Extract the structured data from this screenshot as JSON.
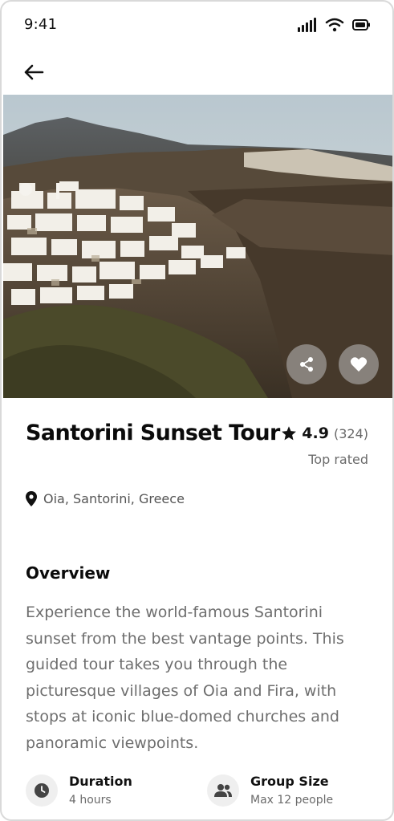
{
  "status_bar": {
    "time": "9:41"
  },
  "tour": {
    "title": "Santorini Sunset Tour",
    "rating": "4.9",
    "reviews": "(324)",
    "badge": "Top rated",
    "location": "Oia, Santorini, Greece"
  },
  "overview": {
    "title": "Overview",
    "description": "Experience the world-famous Santorini sunset from the best vantage points. This guided tour takes you through the picturesque villages of Oia and Fira, with stops at iconic blue-domed churches and panoramic viewpoints."
  },
  "details": [
    {
      "label": "Duration",
      "value": "4 hours",
      "icon": "clock-icon"
    },
    {
      "label": "Group Size",
      "value": "Max 12 people",
      "icon": "group-icon"
    }
  ]
}
